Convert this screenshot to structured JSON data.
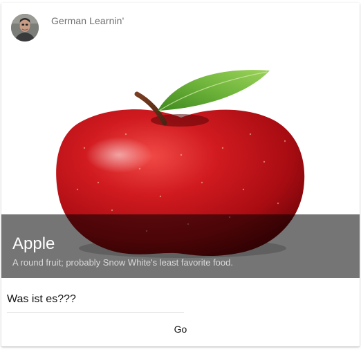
{
  "header": {
    "author_name": "German Learnin'",
    "avatar_icon": "user-avatar"
  },
  "media": {
    "image_subject": "red-apple-image",
    "title": "Apple",
    "subtitle": "A round fruit; probably Snow White's least favorite food."
  },
  "form": {
    "answer_placeholder": "Was ist es???",
    "answer_value": "",
    "submit_label": "Go"
  },
  "colors": {
    "overlay": "#000000",
    "overlay_opacity": "0.54",
    "apple_red": "#c8141a",
    "leaf_green": "#5aa02c",
    "divider": "#e0e0e0"
  }
}
